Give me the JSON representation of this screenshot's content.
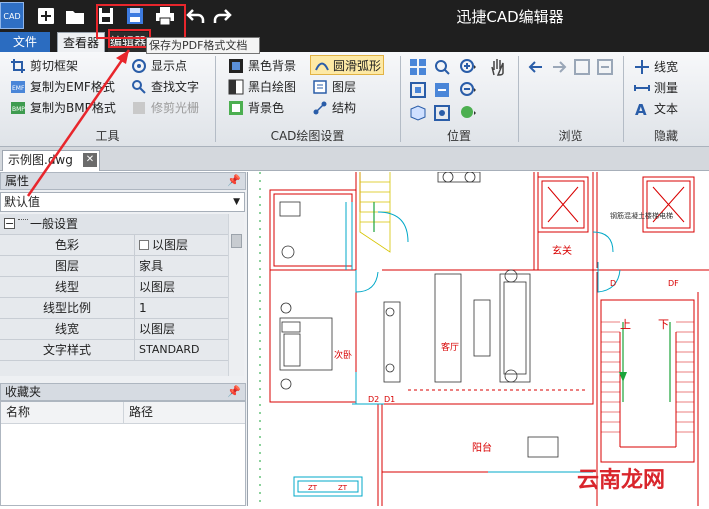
{
  "app": {
    "logo_text": "CAD",
    "title": "迅捷CAD编辑器"
  },
  "quick_access": [
    "new-icon",
    "open-icon",
    "save-icon",
    "save-as-pdf-icon",
    "print-icon",
    "undo-icon",
    "redo-icon"
  ],
  "tabs": {
    "file": "文件",
    "viewer": "查看器",
    "edit": "编辑器"
  },
  "tooltip": "保存为PDF格式文档",
  "ribbon": {
    "tools": {
      "label": "工具",
      "items": [
        {
          "label": "剪切框架",
          "icon": "crop-frame-icon"
        },
        {
          "label": "复制为EMF格式",
          "icon": "copy-emf-icon"
        },
        {
          "label": "复制为BMP格式",
          "icon": "copy-bmp-icon"
        },
        {
          "label": "显示点",
          "icon": "show-points-icon"
        },
        {
          "label": "查找文字",
          "icon": "find-text-icon"
        },
        {
          "label": "修剪光栅",
          "icon": "trim-raster-icon",
          "disabled": true
        }
      ]
    },
    "cad_settings": {
      "label": "CAD绘图设置",
      "items": [
        {
          "label": "黑色背景",
          "icon": "black-background-icon"
        },
        {
          "label": "黑白绘图",
          "icon": "black-white-icon"
        },
        {
          "label": "背景色",
          "icon": "background-color-icon"
        },
        {
          "label": "圆滑弧形",
          "icon": "smooth-arc-icon",
          "active": true
        },
        {
          "label": "图层",
          "icon": "layers-icon"
        },
        {
          "label": "结构",
          "icon": "structure-icon"
        }
      ]
    },
    "position": {
      "label": "位置"
    },
    "browse": {
      "label": "浏览"
    },
    "hide": {
      "label": "隐藏",
      "items": [
        {
          "label": "线宽",
          "icon": "line-width-icon"
        },
        {
          "label": "测量",
          "icon": "measure-icon"
        },
        {
          "label": "文本",
          "icon": "text-icon"
        }
      ]
    }
  },
  "document_tab": {
    "name": "示例图.dwg"
  },
  "properties": {
    "title": "属性",
    "combo_value": "默认值",
    "section": "一般设置",
    "rows": [
      {
        "name": "色彩",
        "value": "以图层"
      },
      {
        "name": "图层",
        "value": "家具"
      },
      {
        "name": "线型",
        "value": "以图层"
      },
      {
        "name": "线型比例",
        "value": "1"
      },
      {
        "name": "线宽",
        "value": "以图层"
      },
      {
        "name": "文字样式",
        "value": "STANDARD"
      }
    ]
  },
  "favorites": {
    "title": "收藏夹",
    "col_name": "名称",
    "col_path": "路径"
  },
  "drawing_labels": {
    "entrance": "玄关",
    "living_room": "客厅",
    "second_bedroom": "次卧",
    "balcony": "阳台",
    "up": "上",
    "down": "下",
    "note": "钢筋混凝土楼梯电梯",
    "door_d2": "D2",
    "door_d1": "D1",
    "door_d": "D",
    "door_df": "DF",
    "window_a": "ZT",
    "window_b": "ZT"
  },
  "watermark": "云南龙网",
  "colors": {
    "accent_blue": "#2b6cc0",
    "annotation_red": "#e8262c",
    "cad_red": "#d80000",
    "cad_cyan": "#00a8c8",
    "cad_yellow": "#d6c400"
  }
}
